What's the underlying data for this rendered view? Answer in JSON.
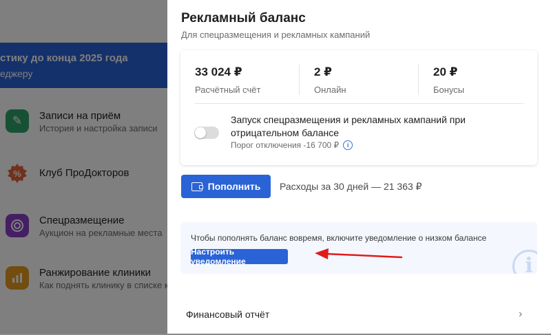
{
  "background": {
    "banner": {
      "line1": "стику до конца 2025 года",
      "line2": "еджеру"
    },
    "items": [
      {
        "title": "Записи на приём",
        "subtitle": "История и настройка записи",
        "icon": "pen-icon",
        "color": "#2ea36a"
      },
      {
        "title": "Клуб ПроДокторов",
        "subtitle": "",
        "icon": "percent-badge-icon",
        "color": "#e0623a"
      },
      {
        "title": "Спецразмещение",
        "subtitle": "Аукцион на рекламные места",
        "icon": "target-icon",
        "color": "#8b3fc9"
      },
      {
        "title": "Ранжирование клиники",
        "subtitle": "Как поднять клинику в списке к",
        "icon": "bar-chart-icon",
        "color": "#e59a1f"
      }
    ]
  },
  "drawer": {
    "title": "Рекламный баланс",
    "subtitle": "Для спецразмещения и рекламных кампаний",
    "stats": [
      {
        "value": "33 024 ₽",
        "label": "Расчётный счёт"
      },
      {
        "value": "2 ₽",
        "label": "Онлайн"
      },
      {
        "value": "20 ₽",
        "label": "Бонусы"
      }
    ],
    "launch_text": "Запуск спецразмещения и рекламных кампаний при отрицательном балансе",
    "toggle_state": "off",
    "threshold": "Порог отключения -16 700 ₽",
    "topup_label": "Пополнить",
    "spend_text": "Расходы за 30 дней — 21 363 ₽",
    "notice_text": "Чтобы пополнять баланс вовремя, включите уведомление о низком балансе",
    "notice_button": "Настроить уведомление",
    "finance_report": "Финансовый отчёт"
  },
  "colors": {
    "accent": "#2a63d6",
    "annotation_arrow": "#e11b1b"
  }
}
